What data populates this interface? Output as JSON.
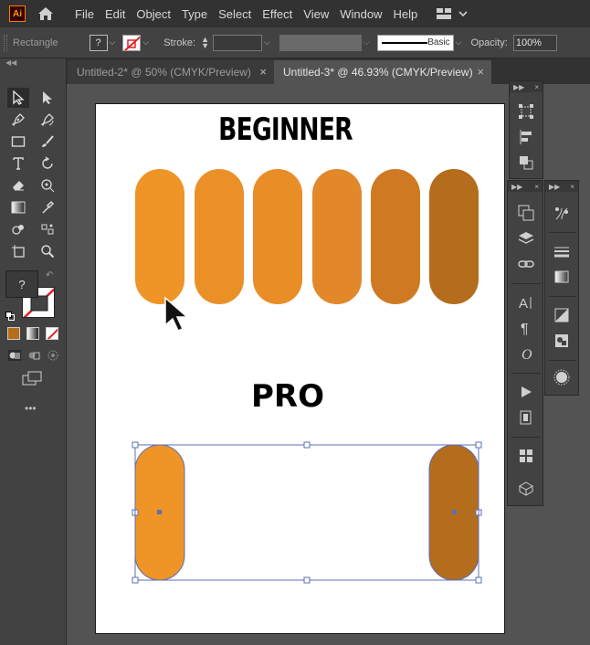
{
  "app": {
    "logo_text": "Ai"
  },
  "menu": [
    "File",
    "Edit",
    "Object",
    "Type",
    "Select",
    "Effect",
    "View",
    "Window",
    "Help"
  ],
  "control_bar": {
    "selection_label": "Rectangle",
    "fill_swatch_glyph": "?",
    "stroke_label": "Stroke:",
    "brush_label": "Basic",
    "opacity_label": "Opacity:",
    "opacity_value": "100%"
  },
  "tabs": [
    {
      "label": "Untitled-2* @ 50% (CMYK/Preview)",
      "active": false
    },
    {
      "label": "Untitled-3* @ 46.93% (CMYK/Preview)",
      "active": true
    }
  ],
  "toolbar": {
    "fill_swatch_glyph": "?",
    "more_tools": "•••"
  },
  "artboard": {
    "heading_top": "BEGINNER",
    "heading_bottom": "PRO",
    "beginner_pills": [
      "#ef9427",
      "#eb9027",
      "#e98d26",
      "#e2872a",
      "#cf7a22",
      "#b36d1c"
    ],
    "pro_pills": [
      "#ef9427",
      "#b36d1c"
    ],
    "selection_color": "#5e6fb5"
  },
  "icons": {
    "home": "home-icon",
    "workspace": "workspace-switcher-icon",
    "panel_menu": "panel-menu-icon"
  }
}
